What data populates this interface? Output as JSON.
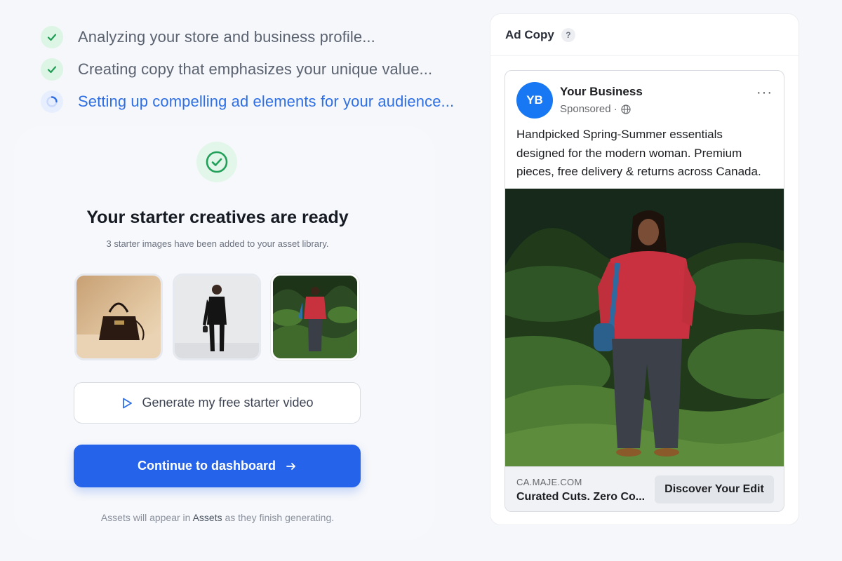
{
  "progress": {
    "steps": [
      {
        "label": "Analyzing your store and business profile...",
        "state": "done"
      },
      {
        "label": "Creating copy that emphasizes your unique value...",
        "state": "done"
      },
      {
        "label": "Setting up compelling ad elements for your audience...",
        "state": "active"
      }
    ]
  },
  "ready": {
    "title": "Your starter creatives are ready",
    "subtitle": "3 starter images have been added to your asset library.",
    "thumbnails": [
      {
        "name": "handbag-image",
        "icon": "photo"
      },
      {
        "name": "black-suit-model-image",
        "icon": "photo"
      },
      {
        "name": "red-jacket-forest-image",
        "icon": "photo"
      }
    ],
    "video_button_label": "Generate my free starter video",
    "continue_button_label": "Continue to dashboard",
    "footer_prefix": "Assets will appear in ",
    "footer_link": "Assets",
    "footer_suffix": " as they finish generating."
  },
  "ad_copy": {
    "panel_title": "Ad Copy",
    "help_icon": "?",
    "post": {
      "avatar_initials": "YB",
      "business_name": "Your Business",
      "sponsored_label": "Sponsored ·",
      "more_icon": "···",
      "body_text": "Handpicked Spring-Summer essentials designed for the modern woman. Premium pieces, free delivery & returns across Canada.",
      "domain": "CA.MAJE.COM",
      "headline": "Curated Cuts. Zero Co...",
      "cta_label": "Discover Your Edit"
    }
  },
  "colors": {
    "accent": "#2563eb",
    "success": "#22a05a",
    "facebook_blue": "#1877f2"
  }
}
